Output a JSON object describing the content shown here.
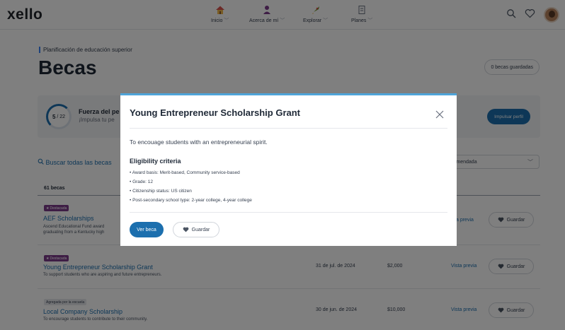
{
  "header": {
    "logo": "xello",
    "nav": [
      {
        "label": "Inicio",
        "icon": "house-icon"
      },
      {
        "label": "Acerca de mí",
        "icon": "person-icon"
      },
      {
        "label": "Explorar",
        "icon": "rocket-icon"
      },
      {
        "label": "Planes",
        "icon": "notebook-icon"
      }
    ]
  },
  "page": {
    "breadcrumb": "Planificación de educación superior",
    "title": "Becas",
    "saved_count": "0 becas guardadas"
  },
  "profile_strength": {
    "score": "5",
    "total": "/ 22",
    "title": "Fuerza del pe",
    "subtitle": "¡Impulsa tu pe",
    "boost_label": "Impulsar perfil"
  },
  "search": {
    "label": "Buscar todas las becas"
  },
  "sort": {
    "value": "comendada"
  },
  "list": {
    "count": "61 becas",
    "preview_label": "Vista previa",
    "save_label": "Guardar",
    "rows": [
      {
        "badge": "Destacada",
        "title": "AEF Scholarships",
        "desc1": "Ascend Educational Fund award",
        "desc2": "graduating from a Kentucky high",
        "date": "",
        "amount": "",
        "preview": "ista previa"
      },
      {
        "badge": "Destacada",
        "title": "Young Entrepreneur Scholarship Grant",
        "desc1": "To support students who are aspiring and future entrepreneurs.",
        "date": "31 de jul. de 2024",
        "amount": "$2,000",
        "preview": "Vista previa"
      },
      {
        "badge": "Agregada por la escuela",
        "title": "Local Company Scholarship",
        "desc1": "To encourage students to contribute to their community.",
        "date": "30 de jun. de 2024",
        "amount": "$10,000",
        "preview": "Vista previa"
      }
    ]
  },
  "modal": {
    "title": "Young Entrepreneur Scholarship Grant",
    "description": "To encouage students with an entrepreneurial spirit.",
    "criteria_title": "Eligibility criteria",
    "criteria": [
      "• Award basis: Merit-based, Community service-based",
      "• Grade: 12",
      "• Citizenship status: US citizen",
      "• Post-secondary school type: 2-year college, 4-year college"
    ],
    "view_label": "Ver beca",
    "save_label": "Guardar"
  },
  "colors": {
    "primary": "#1c6fae",
    "featured_badge": "#7c3a8a",
    "modal_accent": "#4fa4d9"
  }
}
